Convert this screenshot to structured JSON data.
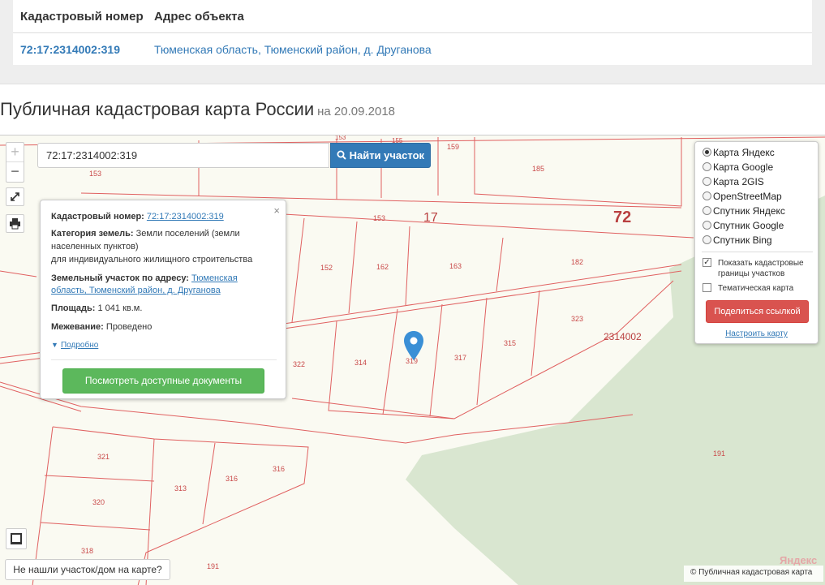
{
  "results_table": {
    "headers": [
      "Кадастровый номер",
      "Адрес объекта"
    ],
    "rows": [
      {
        "cadastral_number": "72:17:2314002:319",
        "address": "Тюменская область, Тюменский район, д. Друганова"
      }
    ]
  },
  "page": {
    "title": "Публичная кадастровая карта России",
    "date": "на 20.09.2018"
  },
  "map_controls": {
    "zoom_in": "+",
    "zoom_out": "−",
    "search_value": "72:17:2314002:319",
    "search_button": "Найти участок",
    "not_found": "Не нашли участок/дом на карте?"
  },
  "popup": {
    "close": "×",
    "cadastral_label": "Кадастровый номер:",
    "cadastral_value": "72:17:2314002:319",
    "category_label": "Категория земель:",
    "category_value_1": "Земли поселений (земли",
    "category_value_2": "населенных пунктов)",
    "category_value_3": "для индивидуального жилищного строительства",
    "address_label": "Земельный участок по адресу:",
    "address_value_1": "Тюменская",
    "address_value_2": "область, Тюменский район, д. Друганова",
    "area_label": "Площадь:",
    "area_value": "1 041 кв.м.",
    "survey_label": "Межевание:",
    "survey_value": "Проведено",
    "more_link": "Подробно",
    "docs_button": "Посмотреть доступные документы"
  },
  "layers_panel": {
    "base_layers": [
      {
        "label": "Карта Яндекс",
        "selected": true
      },
      {
        "label": "Карта Google",
        "selected": false
      },
      {
        "label": "Карта 2GIS",
        "selected": false
      },
      {
        "label": "OpenStreetMap",
        "selected": false
      },
      {
        "label": "Спутник Яндекс",
        "selected": false
      },
      {
        "label": "Спутник Google",
        "selected": false
      },
      {
        "label": "Спутник Bing",
        "selected": false
      }
    ],
    "show_borders_1": "Показать кадастровые",
    "show_borders_2": "границы участков",
    "show_borders_checked": true,
    "thematic_map": "Тематическая карта",
    "thematic_checked": false,
    "share_button": "Поделиться ссылкой",
    "setup_link": "Настроить карту"
  },
  "map_labels": {
    "district": "17",
    "region": "72",
    "quarter": "2314002",
    "parcels": [
      "153",
      "155",
      "159",
      "185",
      "153",
      "152",
      "162",
      "163",
      "182",
      "322",
      "314",
      "319",
      "317",
      "315",
      "323",
      "191",
      "321",
      "313",
      "316",
      "320",
      "318",
      "191"
    ]
  },
  "attribution": {
    "copyright": "© Публичная кадастровая карта",
    "yandex": "Яндекс"
  },
  "colors": {
    "link": "#337ab7",
    "search_button": "#337ab7",
    "docs_button": "#5cb85c",
    "share_button": "#d9534f",
    "parcel_border": "#e06060",
    "map_background": "#fafaf2",
    "forest": "#d9e6d0"
  }
}
